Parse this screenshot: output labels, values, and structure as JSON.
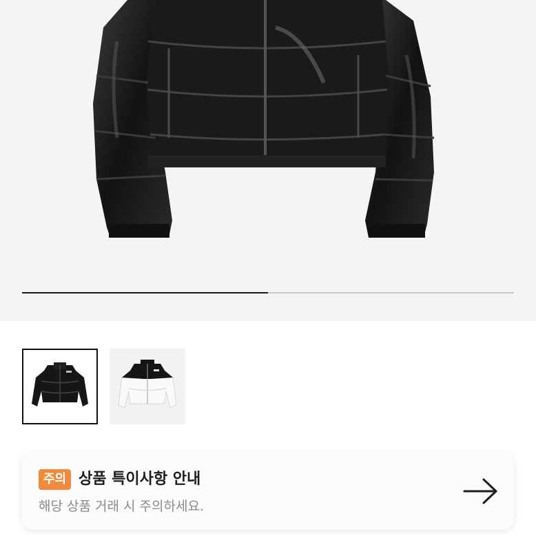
{
  "gallery": {
    "image_alt": "black cropped puffer jacket",
    "progress_fraction": 0.5,
    "thumbnails": [
      {
        "icon": "black-jacket-thumbnail",
        "selected": true
      },
      {
        "icon": "white-jacket-thumbnail",
        "selected": false
      }
    ]
  },
  "notice": {
    "badge": "주의",
    "title": "상품 특이사항 안내",
    "description": "해당 상품 거래 시 주의하세요.",
    "arrow_icon": "arrow-right-icon"
  },
  "colors": {
    "badge": "#f08a3c",
    "hero_background": "#f4f4f4",
    "progress_fill": "#1a1a1a",
    "progress_track": "#c9c9c9"
  }
}
